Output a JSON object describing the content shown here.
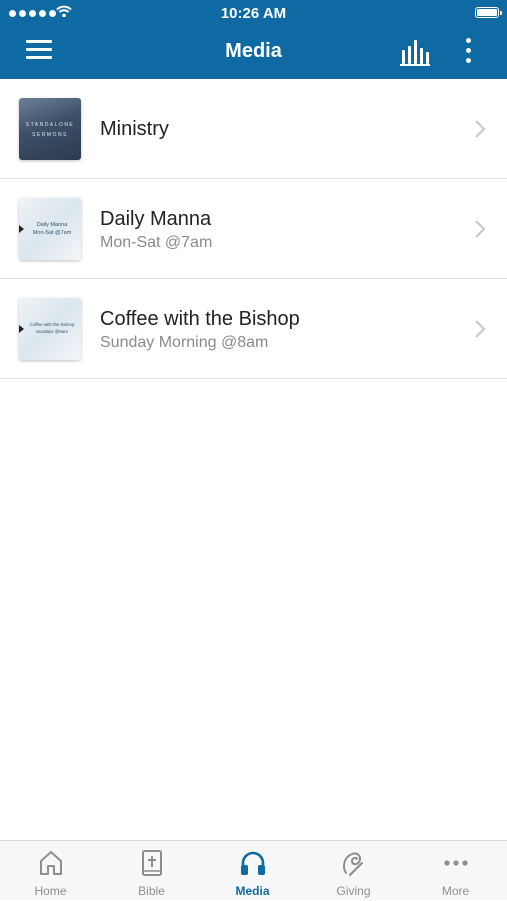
{
  "status_bar": {
    "time": "10:26 AM"
  },
  "header": {
    "title": "Media"
  },
  "media_list": [
    {
      "title": "Ministry",
      "subtitle": "",
      "thumb_lines": [
        "STANDALONE",
        "SERMONS"
      ]
    },
    {
      "title": "Daily Manna",
      "subtitle": "Mon-Sat @7am",
      "thumb_lines": [
        "Daily Manna",
        "Mon-Sat @7am"
      ]
    },
    {
      "title": "Coffee with the Bishop",
      "subtitle": "Sunday Morning @8am",
      "thumb_lines": [
        "Coffee with the Bishop",
        "Sundays @8am"
      ]
    }
  ],
  "tab_bar": {
    "tabs": [
      {
        "label": "Home",
        "icon": "home-icon"
      },
      {
        "label": "Bible",
        "icon": "bible-icon"
      },
      {
        "label": "Media",
        "icon": "headphones-icon",
        "active": true
      },
      {
        "label": "Giving",
        "icon": "giving-icon"
      },
      {
        "label": "More",
        "icon": "more-dots-icon"
      }
    ]
  },
  "colors": {
    "accent": "#0f6aa3",
    "tab_inactive": "#8e8e8e"
  }
}
